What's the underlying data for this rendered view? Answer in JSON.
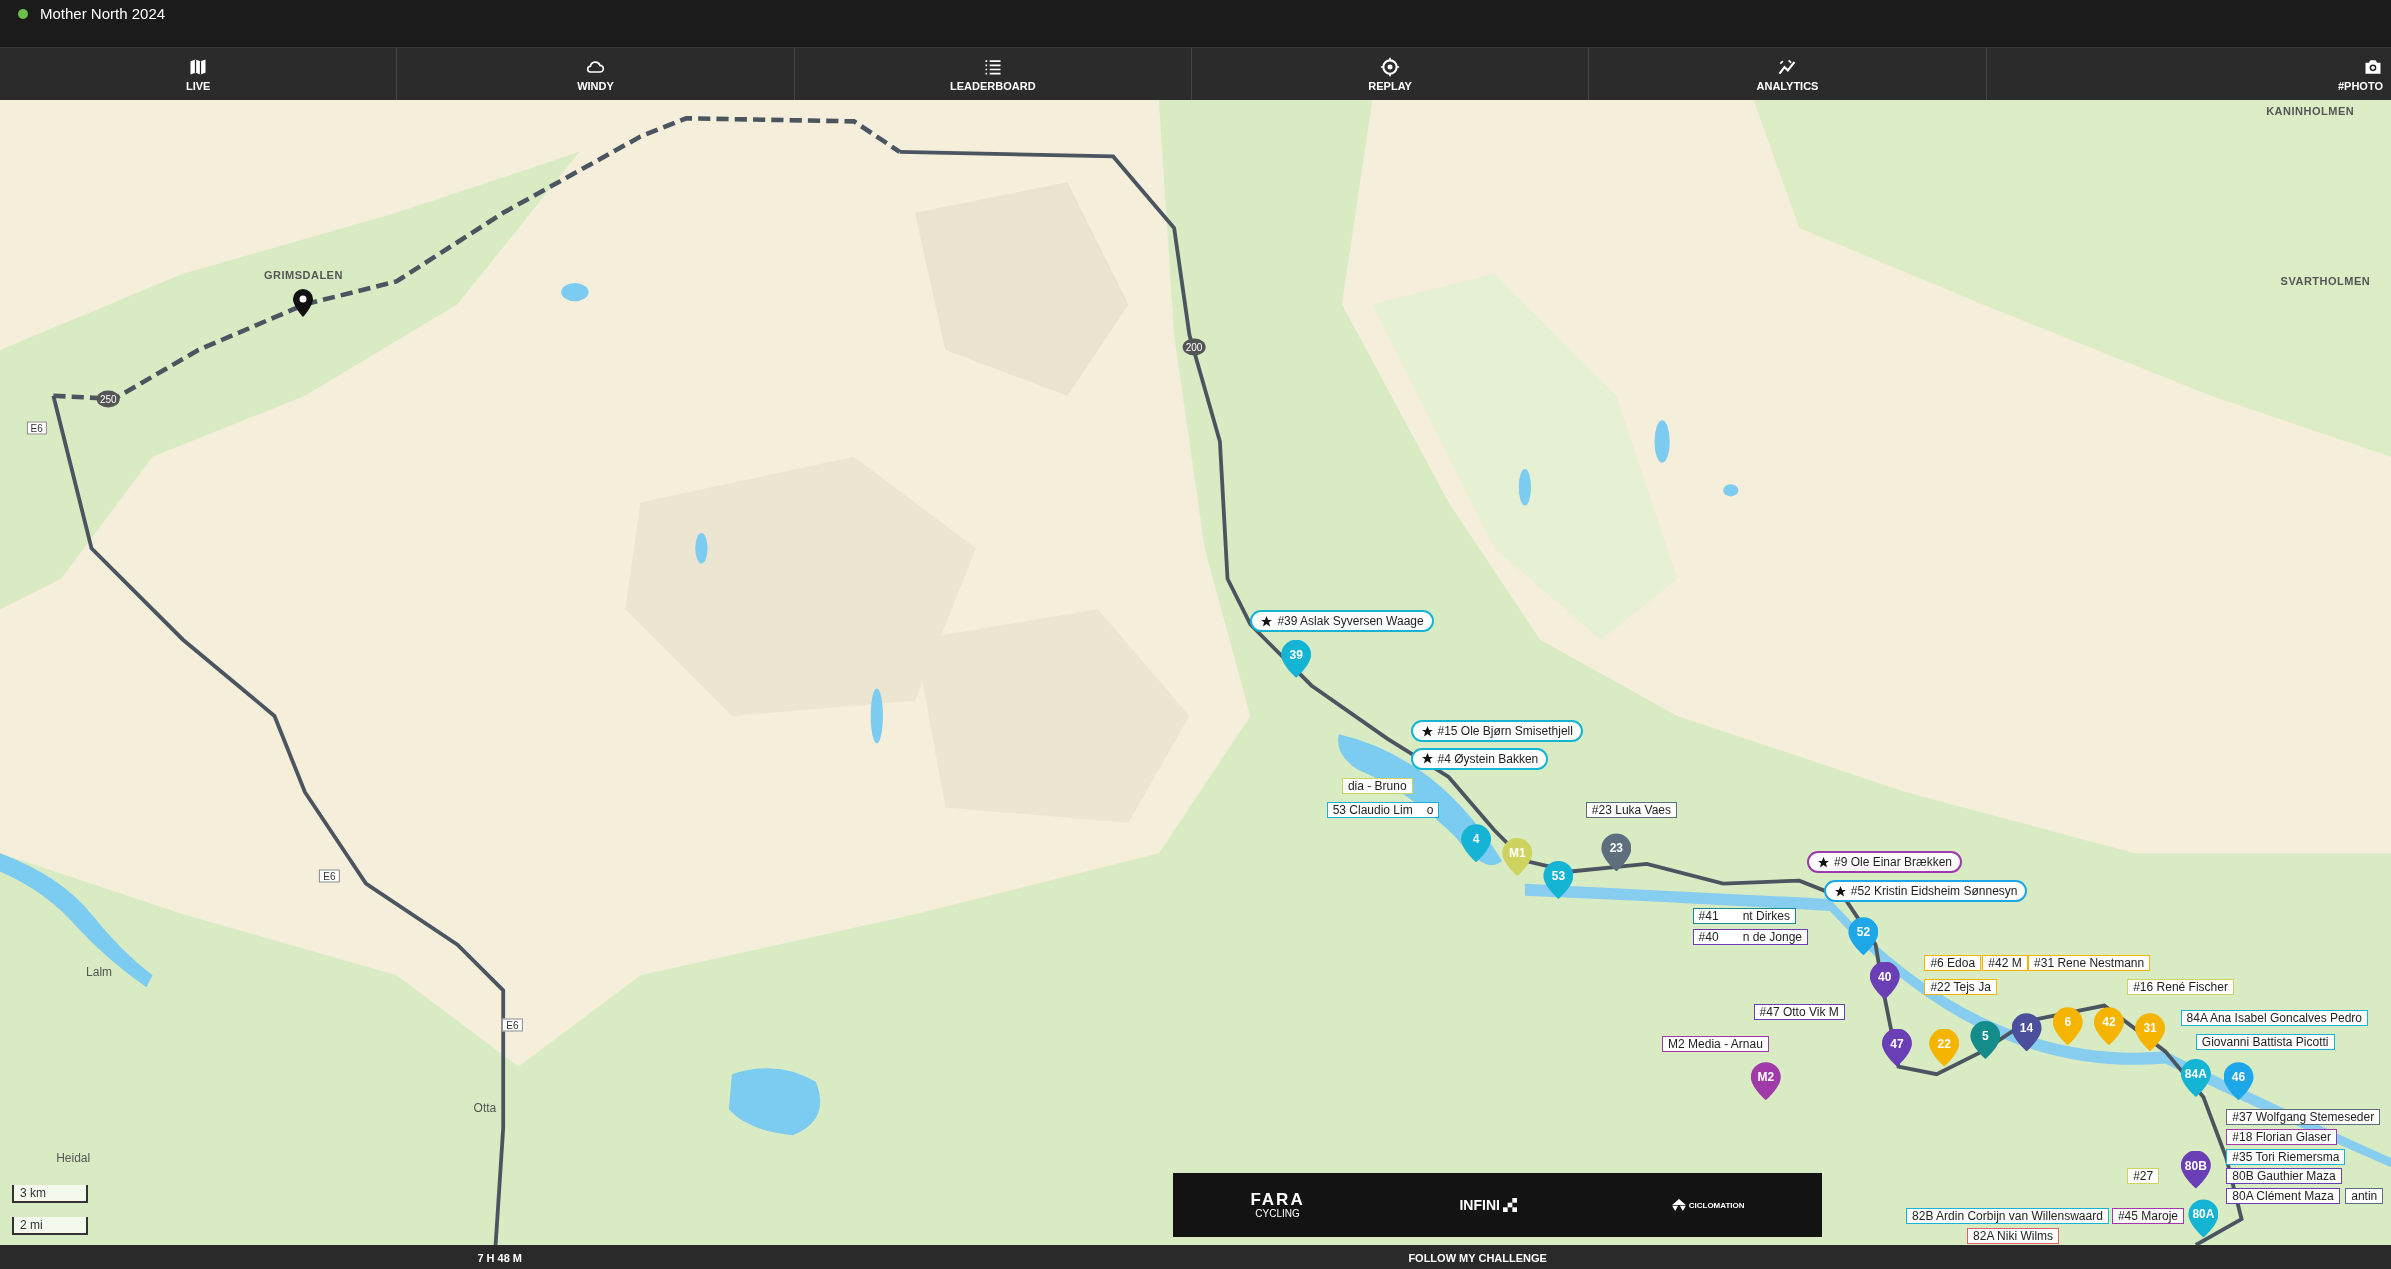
{
  "header": {
    "title": "Mother North 2024"
  },
  "nav": [
    {
      "label": "LIVE"
    },
    {
      "label": "WINDY"
    },
    {
      "label": "LEADERBOARD"
    },
    {
      "label": "REPLAY"
    },
    {
      "label": "ANALYTICS"
    },
    {
      "label": "#PHOTO"
    }
  ],
  "map": {
    "places": [
      {
        "text": "GRIMSDALEN",
        "kind": "marker"
      },
      {
        "text": "KANINHOLMEN",
        "kind": "place"
      },
      {
        "text": "SVARTHOLMEN",
        "kind": "place"
      },
      {
        "text": "Lalm",
        "kind": "town"
      },
      {
        "text": "Heidal",
        "kind": "town"
      },
      {
        "text": "Otta",
        "kind": "town"
      },
      {
        "text": "250",
        "kind": "road_circle"
      },
      {
        "text": "200",
        "kind": "road_circle"
      },
      {
        "text": "E6",
        "kind": "road_rect"
      },
      {
        "text": "E6",
        "kind": "road_rect"
      },
      {
        "text": "E6",
        "kind": "road_rect"
      }
    ],
    "pins": [
      {
        "text": "39",
        "color": "#16b4d4"
      },
      {
        "text": "4",
        "color": "#16b4d4"
      },
      {
        "text": "M1",
        "color": "#cdd35e"
      },
      {
        "text": "53",
        "color": "#16b4d4"
      },
      {
        "text": "23",
        "color": "#5d6f7c"
      },
      {
        "text": "52",
        "color": "#1ea7e8"
      },
      {
        "text": "40",
        "color": "#6a3fb5"
      },
      {
        "text": "47",
        "color": "#6a3fb5"
      },
      {
        "text": "M2",
        "color": "#a03aa8"
      },
      {
        "text": "22",
        "color": "#f5b400"
      },
      {
        "text": "5",
        "color": "#148c8c"
      },
      {
        "text": "14",
        "color": "#4b4f9c"
      },
      {
        "text": "6",
        "color": "#f5b400"
      },
      {
        "text": "42",
        "color": "#f5b400"
      },
      {
        "text": "31",
        "color": "#f5b400"
      },
      {
        "text": "84A",
        "color": "#16b4d4"
      },
      {
        "text": "46",
        "color": "#1ea7e8"
      },
      {
        "text": "80B",
        "color": "#6a3fb5"
      },
      {
        "text": "80A",
        "color": "#16b4d4"
      }
    ],
    "labels": [
      {
        "parts": [
          "#39 Aslak Syversen Waage"
        ],
        "starred": true,
        "color": "#16b4d4"
      },
      {
        "parts": [
          "#15 Ole Bjørn Smisethjell"
        ],
        "starred": true,
        "color": "#16b4d4"
      },
      {
        "parts": [
          "#4 Øystein Bakken"
        ],
        "starred": true,
        "color": "#16b4d4"
      },
      {
        "parts": [
          "dia - Bruno"
        ],
        "starred": false,
        "color": "#cdd35e"
      },
      {
        "parts": [
          "#23 Luka Vaes"
        ],
        "starred": false,
        "color": "#5d6f7c"
      },
      {
        "parts": [
          "53 Claudio Lim",
          "o"
        ],
        "starred": false,
        "color": "#16b4d4"
      },
      {
        "parts": [
          "#9 Ole Einar Brækken"
        ],
        "starred": true,
        "color": "#9b3aa8"
      },
      {
        "parts": [
          "#52 Kristin Eidsheim Sønnesyn"
        ],
        "starred": true,
        "color": "#1ea7e8"
      },
      {
        "parts": [
          "#41",
          "nt Dirkes"
        ],
        "starred": false,
        "color": "#148c8c"
      },
      {
        "parts": [
          "#40",
          "n de Jonge"
        ],
        "starred": false,
        "color": "#6a3fb5"
      },
      {
        "parts": [
          "#47 Otto Vik M"
        ],
        "starred": false,
        "color": "#6a3fb5"
      },
      {
        "parts": [
          "M2 Media - Arnau"
        ],
        "starred": false,
        "color": "#a03aa8"
      },
      {
        "parts": [
          "#6 Edoa"
        ],
        "starred": false,
        "color": "#f5b400"
      },
      {
        "parts": [
          "#42 M"
        ],
        "starred": false,
        "color": "#f5b400"
      },
      {
        "parts": [
          "#31 Rene Nestmann"
        ],
        "starred": false,
        "color": "#f5b400"
      },
      {
        "parts": [
          "#22 Tejs Ja"
        ],
        "starred": false,
        "color": "#f5b400"
      },
      {
        "parts": [
          "#16 René Fischer"
        ],
        "starred": false,
        "color": "#cdd35e"
      },
      {
        "parts": [
          "84A Ana Isabel Goncalves Pedro"
        ],
        "starred": false,
        "color": "#16b4d4"
      },
      {
        "parts": [
          "Giovanni Battista Picotti"
        ],
        "starred": false,
        "color": "#16b4d4"
      },
      {
        "parts": [
          "#37 Wolfgang Stemeseder"
        ],
        "starred": false,
        "color": "#5d6f7c"
      },
      {
        "parts": [
          "#18 Florian Glaser"
        ],
        "starred": false,
        "color": "#a03aa8"
      },
      {
        "parts": [
          "#35 Tori Riemersma"
        ],
        "starred": false,
        "color": "#16b4d4"
      },
      {
        "parts": [
          "80B Gauthier Maza"
        ],
        "starred": false,
        "color": "#6a3fb5"
      },
      {
        "parts": [
          "80A Clément Maza"
        ],
        "starred": false,
        "color": "#6a3fb5"
      },
      {
        "parts": [
          "antin"
        ],
        "starred": false,
        "color": "#5d6f7c"
      },
      {
        "parts": [
          "#27"
        ],
        "starred": false,
        "color": "#cdd35e"
      },
      {
        "parts": [
          "#45 Maroje"
        ],
        "starred": false,
        "color": "#a03aa8"
      },
      {
        "parts": [
          "82B Ardin Corbijn van Willenswaard"
        ],
        "starred": false,
        "color": "#16b4d4"
      },
      {
        "parts": [
          "82A Niki Wilms"
        ],
        "starred": false,
        "color": "#e0606e"
      }
    ],
    "scale": [
      "3 km",
      "2 mi"
    ],
    "sponsors": {
      "fara": [
        "FARA",
        "CYCLING"
      ],
      "infini": "INFINI",
      "ciclomation": "CICLOMATION"
    }
  },
  "footer": {
    "elapsed": "7 H 48 M",
    "follow": "FOLLOW MY CHALLENGE"
  }
}
